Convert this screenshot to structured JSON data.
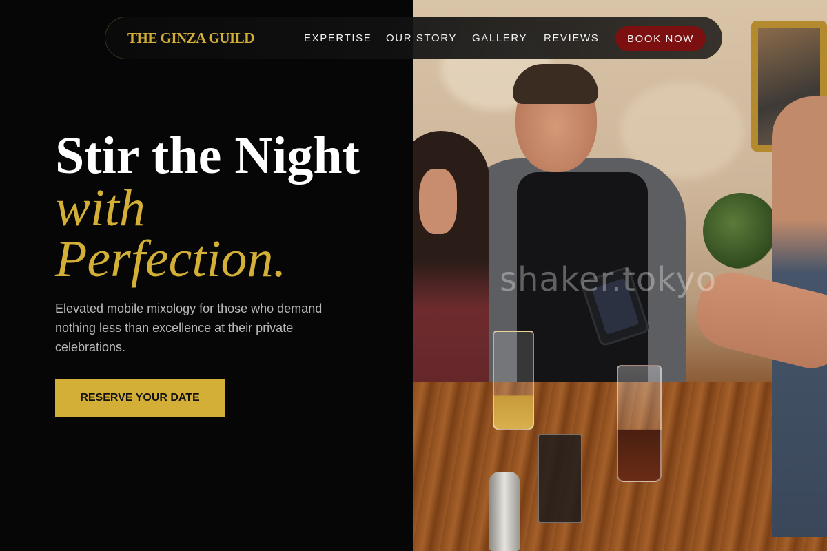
{
  "nav": {
    "brand": "THE GINZA GUILD",
    "links": [
      {
        "label": "EXPERTISE"
      },
      {
        "label": "OUR STORY"
      },
      {
        "label": "GALLERY"
      },
      {
        "label": "REVIEWS"
      }
    ],
    "book_label": "BOOK NOW"
  },
  "hero": {
    "line1": "Stir the Night",
    "line2": "with",
    "line3": "Perfection.",
    "subtitle": "Elevated mobile mixology for those who demand nothing less than excellence at their private celebrations.",
    "cta_label": "RESERVE YOUR DATE"
  },
  "photo": {
    "watermark": "shaker.tokyo"
  },
  "colors": {
    "background": "#060606",
    "accent_gold": "#d4af37",
    "book_button": "#7c0f0f",
    "text_white": "#ffffff",
    "text_muted": "#b9b9b9"
  }
}
